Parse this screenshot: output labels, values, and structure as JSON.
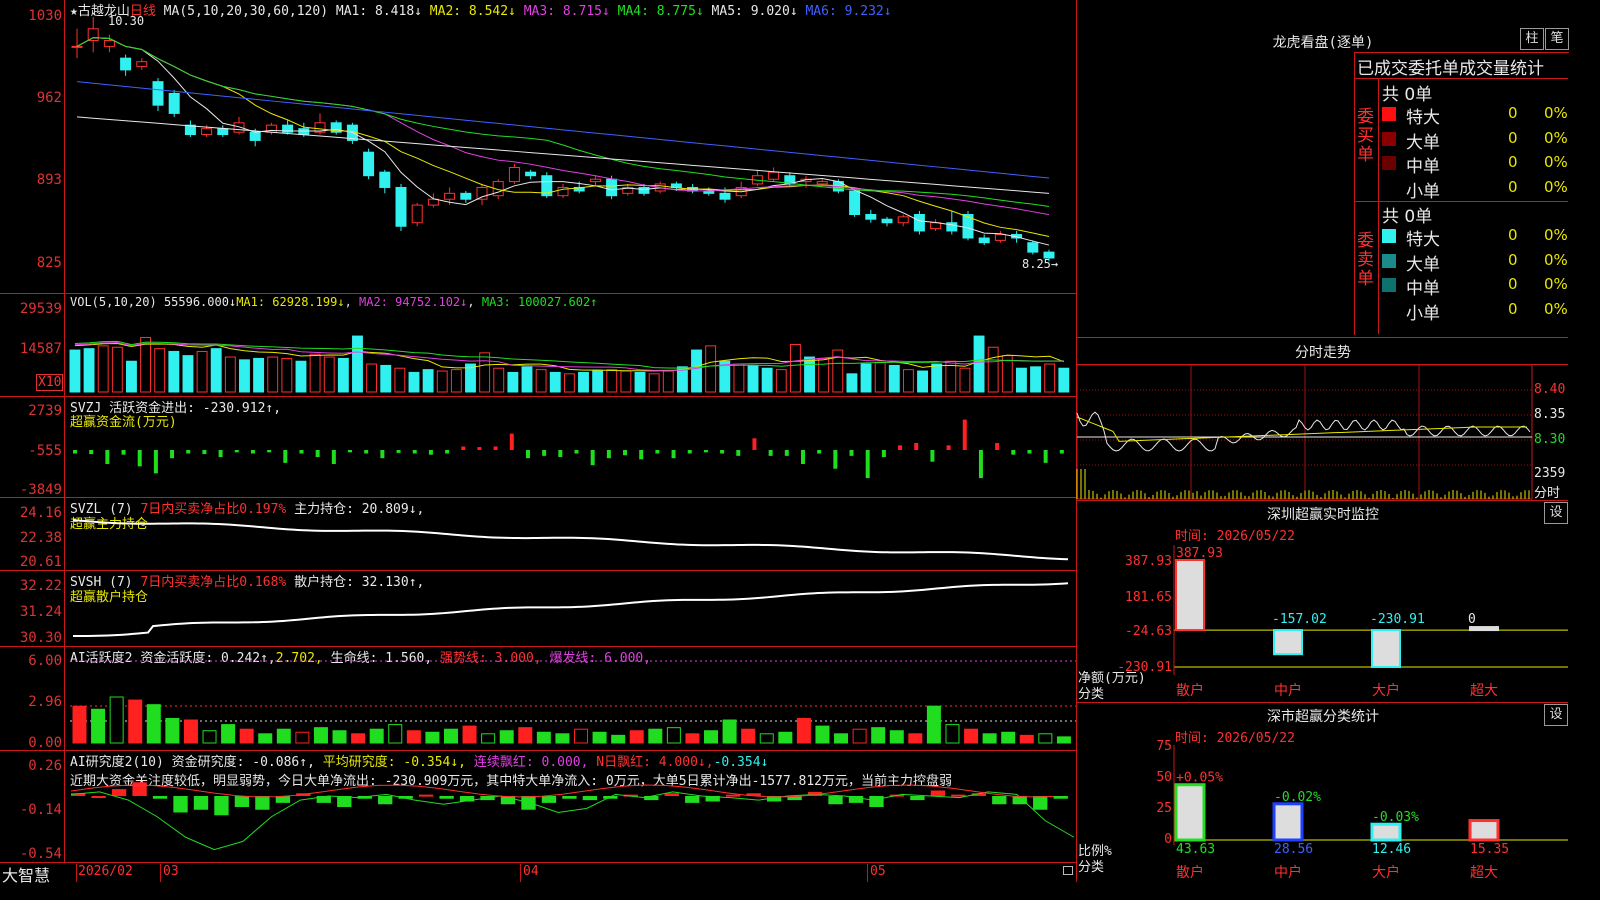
{
  "main": {
    "title": "★古越龙山",
    "period": "日线",
    "ma_header": "MA(5,10,20,30,60,120)",
    "ma": [
      {
        "label": "MA1: 8.418↓",
        "color": "#e8e8e8"
      },
      {
        "label": "MA2: 8.542↓",
        "color": "#e8e800"
      },
      {
        "label": "MA3: 8.715↓",
        "color": "#e040e0"
      },
      {
        "label": "MA4: 8.775↓",
        "color": "#22dd22"
      },
      {
        "label": "MA5: 9.020↓",
        "color": "#e8e8e8"
      },
      {
        "label": "MA6: 9.232↓",
        "color": "#4060ff"
      }
    ],
    "axis": [
      "1030",
      "962",
      "893",
      "825"
    ],
    "high_marker": "10.30",
    "low_marker": "8.25→"
  },
  "vol": {
    "header": "VOL(5,10,20)",
    "val": "55596.000↓",
    "ma1": "MA1: 62928.199↓",
    "ma2": "MA2: 94752.102↓",
    "ma3": "MA3: 100027.602↑",
    "axis": [
      "29539",
      "14587"
    ],
    "unit": "X10"
  },
  "svzj": {
    "header": "SVZJ  活跃资金进出: -230.912↑,",
    "sub": "超赢资金流(万元)",
    "axis": [
      "2739",
      "-555",
      "-3849"
    ]
  },
  "svzl": {
    "header": "SVZL (7)",
    "net": "7日内买卖净占比0.197%",
    "hold": "主力持仓: 20.809↓,",
    "sub": "超赢主力持仓",
    "axis": [
      "24.16",
      "22.38",
      "20.61"
    ]
  },
  "svsh": {
    "header": "SVSH (7)",
    "net": "7日内买卖净占比0.168%",
    "hold": "散户持仓: 32.130↑,",
    "sub": "超赢散户持仓",
    "axis": [
      "32.22",
      "31.24",
      "30.30"
    ]
  },
  "ai_act": {
    "header": "AI活跃度2",
    "v1": "资金活跃度: 0.242↑,",
    "v2": "2.702,",
    "v3": "生命线: 1.560,",
    "v4": "强势线: 3.000,",
    "v5": "爆发线: 6.000,",
    "axis": [
      "6.00",
      "2.96",
      "0.00"
    ]
  },
  "ai_res": {
    "header": "AI研究度2(10)",
    "v1": "资金研究度: -0.086↑,",
    "v2": "平均研究度: -0.354↓,",
    "v3": "连续飘红: 0.000,",
    "v4": "N日飘红: 4.000↓,",
    "v5": "-0.354↓",
    "note": "近期大资金关注度较低，明显弱势，今日大单净流出: -230.909万元，其中特大单净流入: 0万元，大单5日累计净出-1577.812万元，当前主力控盘弱",
    "axis": [
      "0.26",
      "-0.14",
      "-0.54"
    ]
  },
  "bottom": {
    "brand": "大智慧",
    "dates": [
      "2026/02",
      "03",
      "04",
      "05"
    ]
  },
  "right": {
    "lhb_title": "龙虎看盘(逐单)",
    "btn_zhu": "柱",
    "btn_bi": "笔",
    "stat_title": "已成交委托单成交量统计",
    "buy_label": "委买单",
    "sell_label": "委卖单",
    "buy_total": "共 0单",
    "sell_total": "共 0单",
    "buy_rows": [
      {
        "name": "特大",
        "v": "0",
        "p": "0%",
        "color": "#ff1010"
      },
      {
        "name": "大单",
        "v": "0",
        "p": "0%",
        "color": "#8a0000"
      },
      {
        "name": "中单",
        "v": "0",
        "p": "0%",
        "color": "#6a0000"
      },
      {
        "name": "小单",
        "v": "0",
        "p": "0%",
        "color": ""
      }
    ],
    "sell_rows": [
      {
        "name": "特大",
        "v": "0",
        "p": "0%",
        "color": "#30f0f0"
      },
      {
        "name": "大单",
        "v": "0",
        "p": "0%",
        "color": "#1a8a8a"
      },
      {
        "name": "中单",
        "v": "0",
        "p": "0%",
        "color": "#0f7070"
      },
      {
        "name": "小单",
        "v": "0",
        "p": "0%",
        "color": ""
      }
    ],
    "fs_title": "分时走势",
    "fs_axis": [
      "8.40",
      "8.35",
      "8.30"
    ],
    "fs_vol": "2359",
    "fs_vol_lbl": "分时",
    "sz_title": "深圳超赢实时监控",
    "sz_btn": "设",
    "sz_time": "时间: 2026/05/22",
    "sz_axis": [
      "387.93",
      "181.65",
      "-24.63",
      "-230.91"
    ],
    "sz_vals": [
      {
        "label": "387.93",
        "v": 387.93
      },
      {
        "label": "-157.02",
        "v": -157.02
      },
      {
        "label": "-230.91",
        "v": -230.91
      },
      {
        "label": "0",
        "v": 0
      }
    ],
    "sz_ylabel": "净额(万元)",
    "sz_xlabel": "分类",
    "cats": [
      "散户",
      "中户",
      "大户",
      "超大"
    ],
    "fl_title": "深市超赢分类统计",
    "fl_btn": "设",
    "fl_time": "时间: 2026/05/22",
    "fl_axis": [
      "75",
      "50",
      "25",
      "0"
    ],
    "fl_top": [
      "+0.05%",
      "-0.02%",
      "-0.03%",
      ""
    ],
    "fl_vals": [
      43.63,
      28.56,
      12.46,
      15.35
    ],
    "fl_bottom": [
      "43.63",
      "28.56",
      "12.46",
      "15.35"
    ],
    "fl_ylabel": "比例%",
    "fl_xlabel": "分类"
  },
  "chart_data": {
    "type": "bar",
    "title": "古越龙山 日线",
    "candles": [
      [
        10.05,
        10.05,
        9.95,
        10.2
      ],
      [
        10.1,
        10.2,
        10.0,
        10.3
      ],
      [
        10.05,
        10.1,
        10.0,
        10.15
      ],
      [
        9.95,
        9.85,
        9.8,
        9.98
      ],
      [
        9.88,
        9.92,
        9.85,
        9.95
      ],
      [
        9.75,
        9.55,
        9.5,
        9.78
      ],
      [
        9.65,
        9.48,
        9.45,
        9.68
      ],
      [
        9.38,
        9.3,
        9.28,
        9.42
      ],
      [
        9.3,
        9.35,
        9.28,
        9.38
      ],
      [
        9.35,
        9.3,
        9.28,
        9.38
      ],
      [
        9.32,
        9.4,
        9.3,
        9.45
      ],
      [
        9.32,
        9.25,
        9.2,
        9.35
      ],
      [
        9.32,
        9.38,
        9.3,
        9.4
      ],
      [
        9.38,
        9.32,
        9.3,
        9.42
      ],
      [
        9.35,
        9.3,
        9.28,
        9.4
      ],
      [
        9.32,
        9.4,
        9.3,
        9.48
      ],
      [
        9.4,
        9.32,
        9.3,
        9.42
      ],
      [
        9.38,
        9.25,
        9.22,
        9.4
      ],
      [
        9.15,
        8.95,
        8.92,
        9.18
      ],
      [
        8.98,
        8.85,
        8.8,
        9.0
      ],
      [
        8.85,
        8.52,
        8.48,
        8.88
      ],
      [
        8.55,
        8.7,
        8.52,
        8.72
      ],
      [
        8.7,
        8.75,
        8.68,
        8.8
      ],
      [
        8.75,
        8.8,
        8.7,
        8.85
      ],
      [
        8.8,
        8.75,
        8.72,
        8.82
      ],
      [
        8.75,
        8.85,
        8.7,
        8.88
      ],
      [
        8.78,
        8.9,
        8.75,
        8.92
      ],
      [
        8.9,
        9.02,
        8.88,
        9.05
      ],
      [
        8.98,
        8.95,
        8.92,
        9.0
      ],
      [
        8.95,
        8.78,
        8.76,
        8.98
      ],
      [
        8.78,
        8.85,
        8.76,
        8.88
      ],
      [
        8.85,
        8.82,
        8.8,
        8.9
      ],
      [
        8.9,
        8.92,
        8.86,
        8.95
      ],
      [
        8.92,
        8.78,
        8.75,
        8.95
      ],
      [
        8.8,
        8.85,
        8.78,
        8.88
      ],
      [
        8.85,
        8.8,
        8.78,
        8.88
      ],
      [
        8.82,
        8.88,
        8.8,
        8.9
      ],
      [
        8.88,
        8.85,
        8.82,
        8.9
      ],
      [
        8.85,
        8.82,
        8.8,
        8.88
      ],
      [
        8.82,
        8.8,
        8.78,
        8.85
      ],
      [
        8.8,
        8.75,
        8.72,
        8.85
      ],
      [
        8.78,
        8.85,
        8.76,
        8.9
      ],
      [
        8.88,
        8.95,
        8.86,
        9.0
      ],
      [
        8.92,
        8.98,
        8.9,
        9.02
      ],
      [
        8.95,
        8.88,
        8.86,
        8.98
      ],
      [
        8.9,
        8.92,
        8.85,
        8.95
      ],
      [
        8.88,
        8.9,
        8.85,
        8.92
      ],
      [
        8.9,
        8.82,
        8.8,
        8.92
      ],
      [
        8.82,
        8.62,
        8.6,
        8.85
      ],
      [
        8.62,
        8.58,
        8.55,
        8.66
      ],
      [
        8.58,
        8.55,
        8.52,
        8.6
      ],
      [
        8.55,
        8.6,
        8.52,
        8.62
      ],
      [
        8.62,
        8.48,
        8.45,
        8.65
      ],
      [
        8.5,
        8.55,
        8.48,
        8.58
      ],
      [
        8.55,
        8.48,
        8.45,
        8.65
      ],
      [
        8.62,
        8.42,
        8.4,
        8.65
      ],
      [
        8.42,
        8.38,
        8.36,
        8.45
      ],
      [
        8.4,
        8.45,
        8.38,
        8.48
      ],
      [
        8.45,
        8.42,
        8.38,
        8.48
      ],
      [
        8.38,
        8.3,
        8.28,
        8.4
      ],
      [
        8.3,
        8.25,
        8.22,
        8.32
      ]
    ],
    "volume": [
      15000,
      15500,
      16500,
      16000,
      11000,
      19500,
      15500,
      14500,
      13000,
      14500,
      15500,
      12500,
      11500,
      12000,
      12500,
      12000,
      11000,
      13500,
      12500,
      12000,
      20000,
      10000,
      9500,
      8500,
      7000,
      8000,
      7500,
      8000,
      10000,
      14000,
      8500,
      7000,
      9000,
      8000,
      7000,
      6500,
      7000,
      7500,
      8000,
      7500,
      7000,
      6500,
      7500,
      9000,
      15000,
      16500,
      11000,
      10000,
      9500,
      8500,
      8000,
      17000,
      12500,
      12000,
      15000,
      6500,
      10000,
      10500,
      9500,
      8000,
      7500,
      10000,
      11000,
      8500,
      20000,
      16000,
      13000,
      8500,
      9000,
      10000,
      8500
    ],
    "svzj": [
      -300,
      -350,
      -1200,
      -400,
      -1400,
      -2000,
      -700,
      -300,
      -350,
      -600,
      -200,
      -300,
      -200,
      -1100,
      -300,
      -600,
      -1200,
      -200,
      -300,
      -700,
      -250,
      -300,
      -400,
      -300,
      300,
      250,
      300,
      1400,
      -700,
      -500,
      -600,
      -300,
      -1300,
      -700,
      -450,
      -800,
      -300,
      -700,
      -300,
      -200,
      -300,
      -500,
      1000,
      -500,
      -500,
      -1200,
      -300,
      -1600,
      -500,
      -2400,
      -600,
      400,
      600,
      -1000,
      400,
      2600,
      -2400,
      600,
      -400,
      -300,
      -1100,
      -300
    ],
    "ylim_price": [
      8.25,
      10.3
    ]
  }
}
